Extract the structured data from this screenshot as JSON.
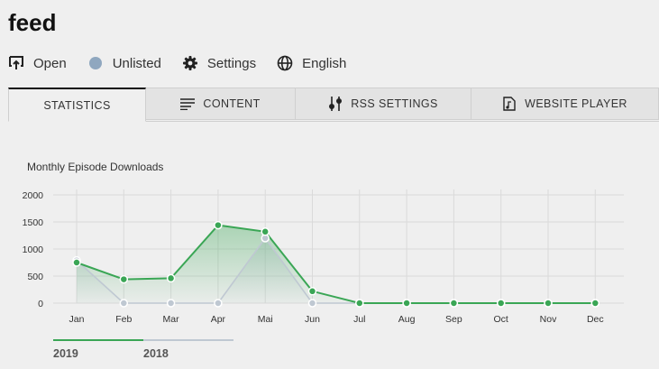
{
  "page": {
    "title": "feed"
  },
  "actions": [
    {
      "label": "Open",
      "icon": "open-external-icon"
    },
    {
      "label": "Unlisted",
      "icon": "status-dot-icon",
      "color": "#8fa7bf"
    },
    {
      "label": "Settings",
      "icon": "gear-icon"
    },
    {
      "label": "English",
      "icon": "globe-icon"
    }
  ],
  "tabs": [
    {
      "label": "STATISTICS",
      "active": true
    },
    {
      "label": "CONTENT",
      "icon": "list-icon"
    },
    {
      "label": "RSS SETTINGS",
      "icon": "sliders-icon"
    },
    {
      "label": "WEBSITE PLAYER",
      "icon": "music-file-icon"
    }
  ],
  "chart_data": {
    "type": "area",
    "title": "Monthly Episode Downloads",
    "categories": [
      "Jan",
      "Feb",
      "Mar",
      "Apr",
      "Mai",
      "Jun",
      "Jul",
      "Aug",
      "Sep",
      "Oct",
      "Nov",
      "Dec"
    ],
    "ylim": [
      0,
      2000
    ],
    "yticks": [
      "0",
      "500",
      "1000",
      "1500",
      "2000"
    ],
    "grid": true,
    "series": [
      {
        "name": "2019",
        "color": "#3aa655",
        "values": [
          750,
          440,
          460,
          1440,
          1320,
          220,
          0,
          0,
          0,
          0,
          0,
          0
        ]
      },
      {
        "name": "2018",
        "color": "#bfc8d2",
        "values": [
          790,
          0,
          0,
          0,
          1200,
          0,
          0,
          0,
          0,
          0,
          0,
          0
        ]
      }
    ],
    "legend": "bottom-left"
  }
}
